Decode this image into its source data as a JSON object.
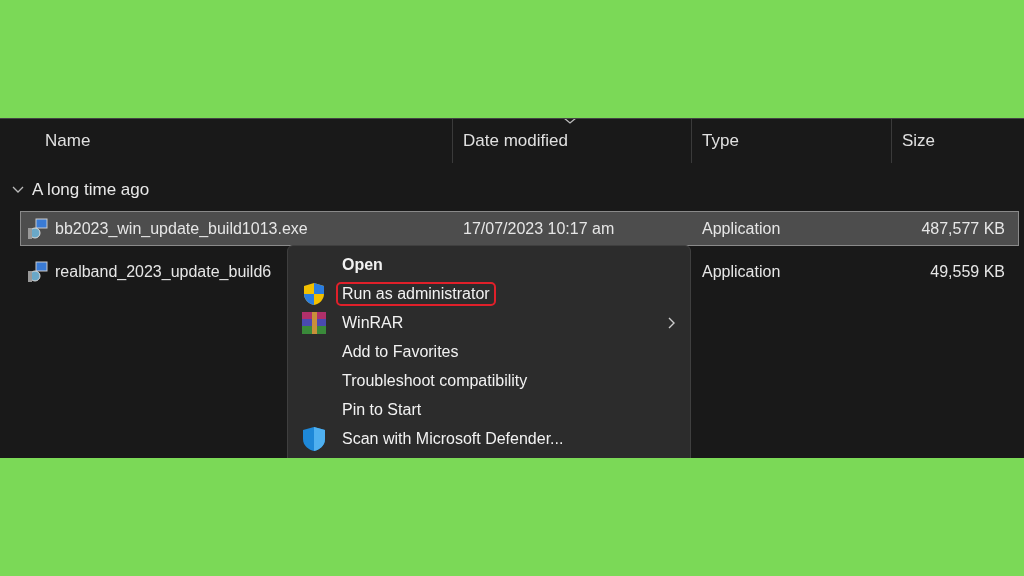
{
  "columns": [
    {
      "label": "Name",
      "sorted": false
    },
    {
      "label": "Date modified",
      "sorted": true
    },
    {
      "label": "Type",
      "sorted": false
    },
    {
      "label": "Size",
      "sorted": false
    }
  ],
  "group": {
    "label": "A long time ago",
    "expanded": true
  },
  "files": [
    {
      "name": "bb2023_win_update_build1013.exe",
      "date": "17/07/2023 10:17 am",
      "type": "Application",
      "size": "487,577 KB",
      "selected": true
    },
    {
      "name": "realband_2023_update_build6",
      "type": "Application",
      "size": "49,559 KB",
      "selected": false
    }
  ],
  "context_menu": [
    {
      "label": "Open",
      "bold": true,
      "highlighted": false,
      "submenu": false
    },
    {
      "label": "Run as administrator",
      "bold": false,
      "highlighted": true,
      "submenu": false
    },
    {
      "label": "WinRAR",
      "bold": false,
      "highlighted": false,
      "submenu": true
    },
    {
      "label": "Add to Favorites",
      "bold": false,
      "highlighted": false,
      "submenu": false
    },
    {
      "label": "Troubleshoot compatibility",
      "bold": false,
      "highlighted": false,
      "submenu": false
    },
    {
      "label": "Pin to Start",
      "bold": false,
      "highlighted": false,
      "submenu": false
    },
    {
      "label": "Scan with Microsoft Defender...",
      "bold": false,
      "highlighted": false,
      "submenu": false
    }
  ]
}
